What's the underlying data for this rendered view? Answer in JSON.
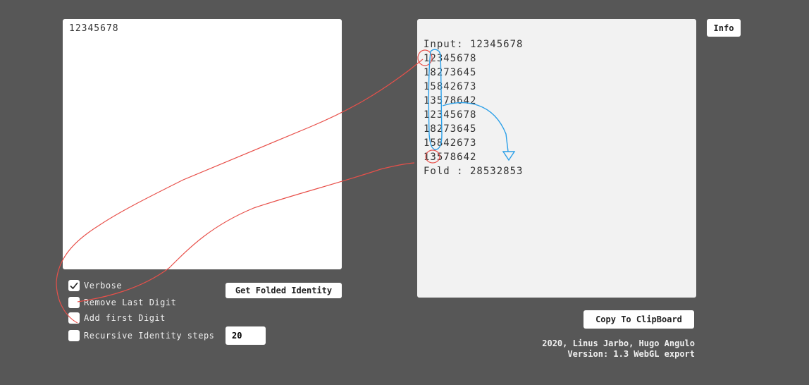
{
  "input": {
    "value": "12345678"
  },
  "output": {
    "lines": [
      "Input: 12345678",
      "12345678",
      "18273645",
      "15842673",
      "13578642",
      "12345678",
      "18273645",
      "15842673",
      "13578642",
      "Fold : 28532853"
    ]
  },
  "buttons": {
    "info": "Info",
    "get_folded": "Get Folded Identity",
    "copy": "Copy To ClipBoard"
  },
  "options": {
    "verbose": {
      "label": "Verbose",
      "checked": true
    },
    "remove_last_digit": {
      "label": "Remove Last Digit",
      "checked": false
    },
    "add_first_digit": {
      "label": "Add first Digit",
      "checked": false
    },
    "recursive_steps": {
      "label": "Recursive Identity steps",
      "checked": false,
      "value": "20"
    }
  },
  "credits": {
    "line1": "2020, Linus Jarbo, Hugo Angulo",
    "line2": "Version: 1.3 WebGL export"
  },
  "colors": {
    "background": "#575757",
    "annotation_red": "#e8504a",
    "annotation_blue": "#2a9fe8"
  }
}
